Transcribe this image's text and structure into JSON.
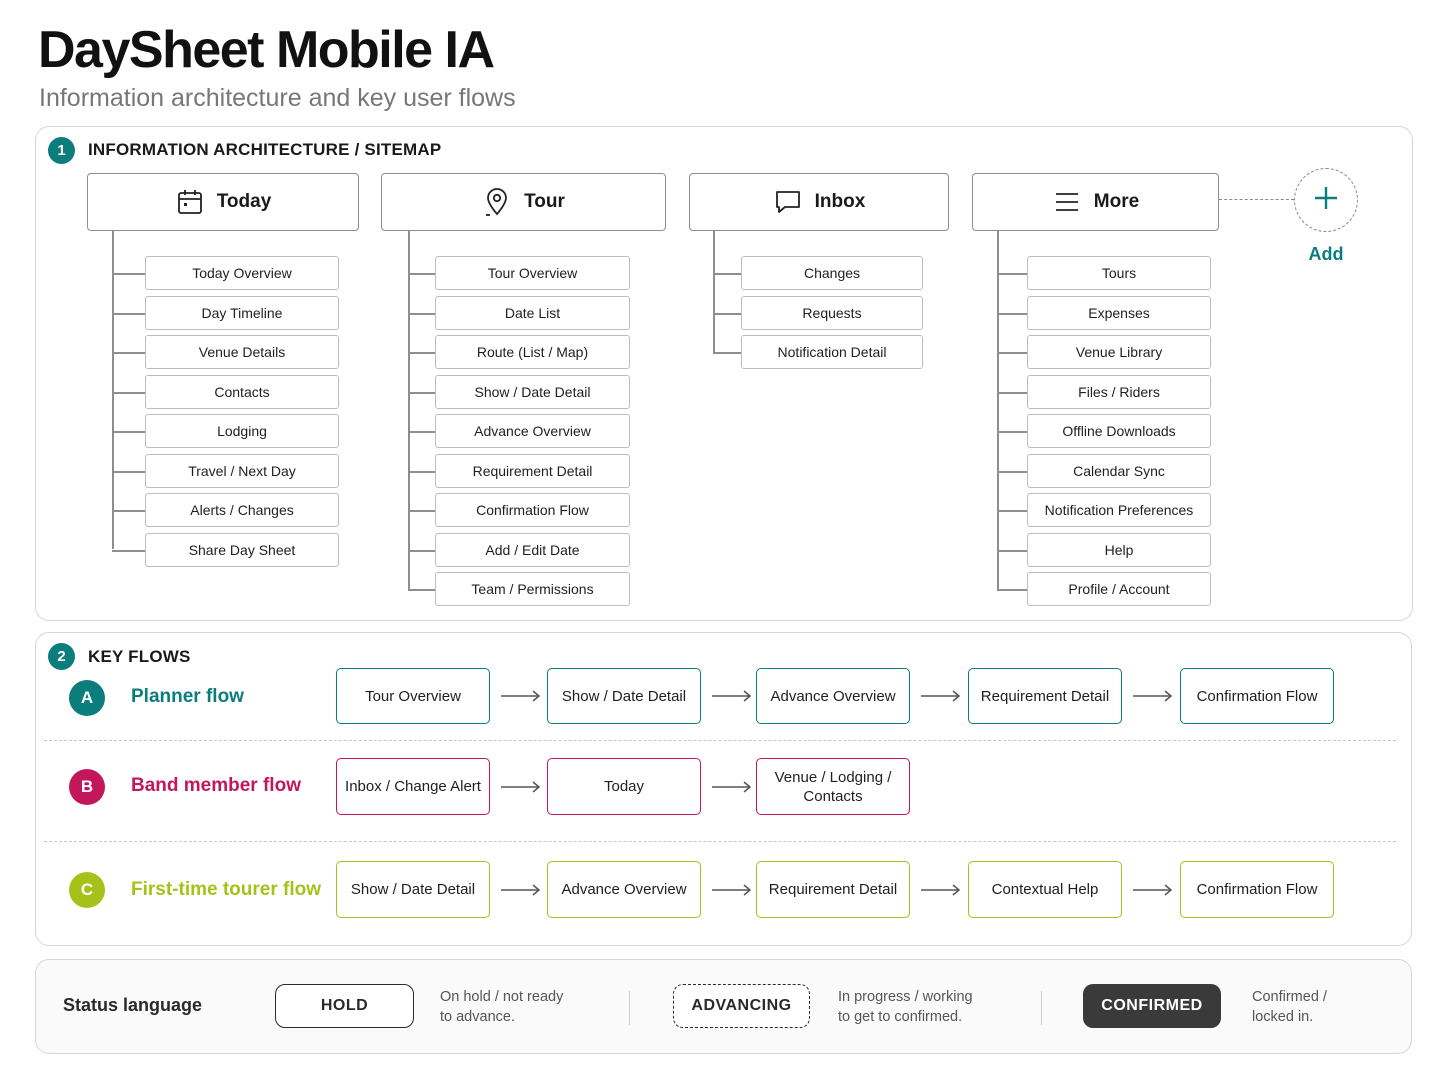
{
  "header": {
    "title": "DaySheet Mobile IA",
    "subtitle": "Information architecture and key user flows"
  },
  "sitemap": {
    "number": "1",
    "title": "INFORMATION ARCHITECTURE / SITEMAP",
    "columns": [
      {
        "label": "Today",
        "icon": "calendar-icon",
        "items": [
          "Today Overview",
          "Day Timeline",
          "Venue Details",
          "Contacts",
          "Lodging",
          "Travel / Next Day",
          "Alerts / Changes",
          "Share Day Sheet"
        ]
      },
      {
        "label": "Tour",
        "icon": "map-pin-icon",
        "items": [
          "Tour Overview",
          "Date List",
          "Route (List / Map)",
          "Show / Date Detail",
          "Advance Overview",
          "Requirement Detail",
          "Confirmation Flow",
          "Add / Edit Date",
          "Team / Permissions"
        ]
      },
      {
        "label": "Inbox",
        "icon": "chat-bubble-icon",
        "items": [
          "Changes",
          "Requests",
          "Notification Detail"
        ]
      },
      {
        "label": "More",
        "icon": "menu-icon",
        "items": [
          "Tours",
          "Expenses",
          "Venue Library",
          "Files / Riders",
          "Offline Downloads",
          "Calendar Sync",
          "Notification Preferences",
          "Help",
          "Profile / Account"
        ]
      }
    ],
    "add": {
      "label": "Add",
      "icon": "plus-icon"
    }
  },
  "flows": {
    "number": "2",
    "title": "KEY FLOWS",
    "items": [
      {
        "letter": "A",
        "name": "Planner flow",
        "color": "#0b7d7d",
        "steps": [
          "Tour Overview",
          "Show / Date Detail",
          "Advance Overview",
          "Requirement Detail",
          "Confirmation Flow"
        ]
      },
      {
        "letter": "B",
        "name": "Band member flow",
        "color": "#c2185b",
        "steps": [
          "Inbox / Change Alert",
          "Today",
          "Venue / Lodging / Contacts"
        ]
      },
      {
        "letter": "C",
        "name": "First-time tourer flow",
        "color": "#a6c21a",
        "steps": [
          "Show / Date Detail",
          "Advance Overview",
          "Requirement Detail",
          "Contextual Help",
          "Confirmation Flow"
        ]
      }
    ]
  },
  "status": {
    "title": "Status language",
    "items": [
      {
        "label": "HOLD",
        "description_line1": "On hold / not ready",
        "description_line2": "to advance."
      },
      {
        "label": "ADVANCING",
        "description_line1": "In progress / working",
        "description_line2": "to get to confirmed."
      },
      {
        "label": "CONFIRMED",
        "description_line1": "Confirmed /",
        "description_line2": "locked in."
      }
    ]
  },
  "colors": {
    "teal": "#0b7d7d",
    "magenta": "#c2185b",
    "lime": "#a6c21a",
    "confirmed_fill": "#3a3a3a"
  }
}
